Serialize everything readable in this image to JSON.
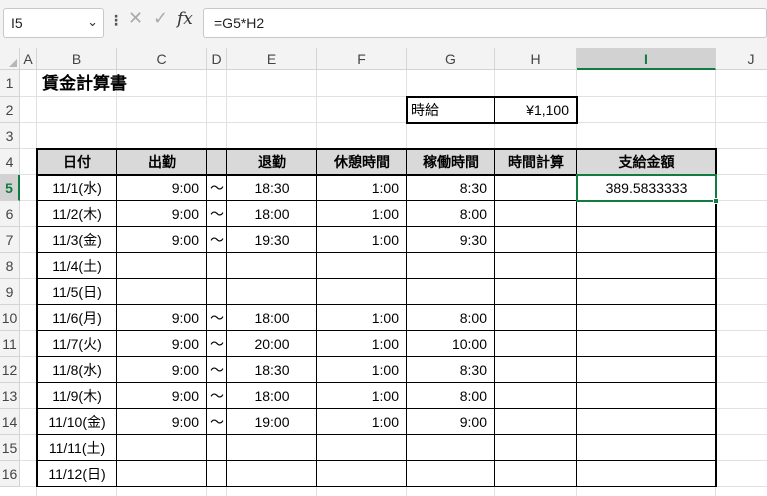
{
  "formula_bar": {
    "name_box": "I5",
    "name_box_icon": "chevron-down-icon",
    "more_icon": "vertical-dots-icon",
    "cancel_icon": "close-icon",
    "enter_icon": "check-icon",
    "fx_label": "fx",
    "formula": "=G5*H2"
  },
  "columns": [
    "A",
    "B",
    "C",
    "D",
    "E",
    "F",
    "G",
    "H",
    "I",
    "J"
  ],
  "selected_column": "I",
  "rows": [
    "1",
    "2",
    "3",
    "4",
    "5",
    "6",
    "7",
    "8",
    "9",
    "10",
    "11",
    "12",
    "13",
    "14",
    "15",
    "16"
  ],
  "selected_row": "5",
  "sheet": {
    "title": "賃金計算書",
    "hourly_label": "時給",
    "hourly_value": "¥1,100",
    "headers": [
      "日付",
      "出勤",
      "",
      "退勤",
      "休憩時間",
      "稼働時間",
      "時間計算",
      "支給金額"
    ],
    "records": [
      {
        "date": "11/1(水)",
        "start": "9:00",
        "sep": "〜",
        "end": "18:30",
        "break": "1:00",
        "work": "8:30",
        "calc": "",
        "pay": "389.5833333"
      },
      {
        "date": "11/2(木)",
        "start": "9:00",
        "sep": "〜",
        "end": "18:00",
        "break": "1:00",
        "work": "8:00",
        "calc": "",
        "pay": ""
      },
      {
        "date": "11/3(金)",
        "start": "9:00",
        "sep": "〜",
        "end": "19:30",
        "break": "1:00",
        "work": "9:30",
        "calc": "",
        "pay": ""
      },
      {
        "date": "11/4(土)",
        "start": "",
        "sep": "",
        "end": "",
        "break": "",
        "work": "",
        "calc": "",
        "pay": ""
      },
      {
        "date": "11/5(日)",
        "start": "",
        "sep": "",
        "end": "",
        "break": "",
        "work": "",
        "calc": "",
        "pay": ""
      },
      {
        "date": "11/6(月)",
        "start": "9:00",
        "sep": "〜",
        "end": "18:00",
        "break": "1:00",
        "work": "8:00",
        "calc": "",
        "pay": ""
      },
      {
        "date": "11/7(火)",
        "start": "9:00",
        "sep": "〜",
        "end": "20:00",
        "break": "1:00",
        "work": "10:00",
        "calc": "",
        "pay": ""
      },
      {
        "date": "11/8(水)",
        "start": "9:00",
        "sep": "〜",
        "end": "18:30",
        "break": "1:00",
        "work": "8:30",
        "calc": "",
        "pay": ""
      },
      {
        "date": "11/9(木)",
        "start": "9:00",
        "sep": "〜",
        "end": "18:00",
        "break": "1:00",
        "work": "8:00",
        "calc": "",
        "pay": ""
      },
      {
        "date": "11/10(金)",
        "start": "9:00",
        "sep": "〜",
        "end": "19:00",
        "break": "1:00",
        "work": "9:00",
        "calc": "",
        "pay": ""
      },
      {
        "date": "11/11(土)",
        "start": "",
        "sep": "",
        "end": "",
        "break": "",
        "work": "",
        "calc": "",
        "pay": ""
      },
      {
        "date": "11/12(日)",
        "start": "",
        "sep": "",
        "end": "",
        "break": "",
        "work": "",
        "calc": "",
        "pay": ""
      }
    ]
  },
  "colors": {
    "selection": "#107c41",
    "header_fill": "#d9d9d9",
    "gridline": "#e1e1e1"
  }
}
